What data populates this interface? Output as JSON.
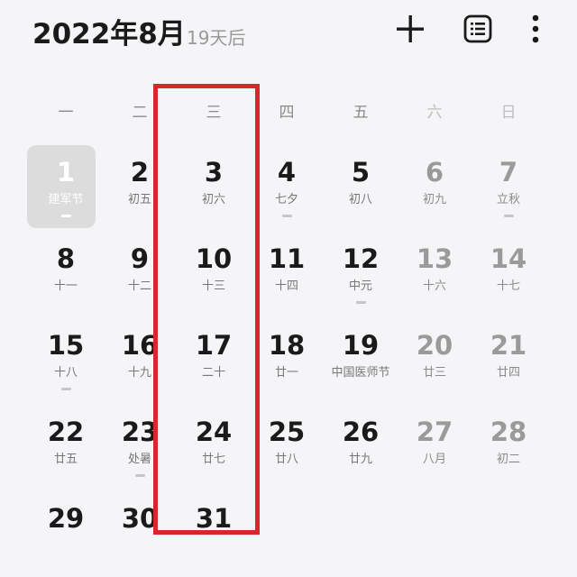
{
  "header": {
    "title": "2022年8月",
    "subtitle": "19天后",
    "add_icon": "plus-icon",
    "list_icon": "list-icon",
    "more_icon": "more-vertical-icon"
  },
  "weekdays": [
    "一",
    "二",
    "三",
    "四",
    "五",
    "六",
    "日"
  ],
  "weeks": [
    [
      {
        "day": "1",
        "lunar": "建军节",
        "dot": true,
        "today": true
      },
      {
        "day": "2",
        "lunar": "初五",
        "dot": false
      },
      {
        "day": "3",
        "lunar": "初六",
        "dot": false
      },
      {
        "day": "4",
        "lunar": "七夕",
        "dot": true
      },
      {
        "day": "5",
        "lunar": "初八",
        "dot": false
      },
      {
        "day": "6",
        "lunar": "初九",
        "dot": false
      },
      {
        "day": "7",
        "lunar": "立秋",
        "dot": true
      }
    ],
    [
      {
        "day": "8",
        "lunar": "十一",
        "dot": false
      },
      {
        "day": "9",
        "lunar": "十二",
        "dot": false
      },
      {
        "day": "10",
        "lunar": "十三",
        "dot": false
      },
      {
        "day": "11",
        "lunar": "十四",
        "dot": false
      },
      {
        "day": "12",
        "lunar": "中元",
        "dot": true
      },
      {
        "day": "13",
        "lunar": "十六",
        "dot": false
      },
      {
        "day": "14",
        "lunar": "十七",
        "dot": false
      }
    ],
    [
      {
        "day": "15",
        "lunar": "十八",
        "dot": true
      },
      {
        "day": "16",
        "lunar": "十九",
        "dot": false
      },
      {
        "day": "17",
        "lunar": "二十",
        "dot": false
      },
      {
        "day": "18",
        "lunar": "廿一",
        "dot": false
      },
      {
        "day": "19",
        "lunar": "中国医师节",
        "dot": false
      },
      {
        "day": "20",
        "lunar": "廿三",
        "dot": false
      },
      {
        "day": "21",
        "lunar": "廿四",
        "dot": false
      }
    ],
    [
      {
        "day": "22",
        "lunar": "廿五",
        "dot": false
      },
      {
        "day": "23",
        "lunar": "处暑",
        "dot": true
      },
      {
        "day": "24",
        "lunar": "廿七",
        "dot": false
      },
      {
        "day": "25",
        "lunar": "廿八",
        "dot": false
      },
      {
        "day": "26",
        "lunar": "廿九",
        "dot": false
      },
      {
        "day": "27",
        "lunar": "八月",
        "dot": false
      },
      {
        "day": "28",
        "lunar": "初二",
        "dot": false
      }
    ],
    [
      {
        "day": "29",
        "lunar": "",
        "dot": false
      },
      {
        "day": "30",
        "lunar": "",
        "dot": false
      },
      {
        "day": "31",
        "lunar": "",
        "dot": false
      }
    ]
  ],
  "colors": {
    "background": "#f5f5f7",
    "highlight_border": "#d8262b",
    "today_bg": "#dcdcdc",
    "weekend_text": "#9a9a9a"
  }
}
